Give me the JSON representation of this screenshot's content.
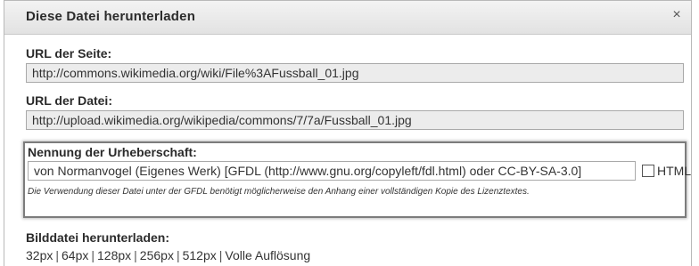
{
  "dialog": {
    "title": "Diese Datei herunterladen",
    "close_symbol": "×"
  },
  "page_url": {
    "label": "URL der Seite:",
    "value": "http://commons.wikimedia.org/wiki/File%3AFussball_01.jpg"
  },
  "file_url": {
    "label": "URL der Datei:",
    "value": "http://upload.wikimedia.org/wikipedia/commons/7/7a/Fussball_01.jpg"
  },
  "attribution": {
    "label": "Nennung der Urheberschaft:",
    "value": "von Normanvogel (Eigenes Werk) [GFDL (http://www.gnu.org/copyleft/fdl.html) oder CC-BY-SA-3.0]",
    "html_label": "HTML",
    "html_checked": false,
    "notice": "Die Verwendung dieser Datei unter der GFDL benötigt möglicherweise den Anhang einer vollständigen Kopie des Lizenztextes."
  },
  "download": {
    "label": "Bilddatei herunterladen:",
    "sizes": [
      "32px",
      "64px",
      "128px",
      "256px",
      "512px",
      "Volle Auflösung"
    ]
  }
}
